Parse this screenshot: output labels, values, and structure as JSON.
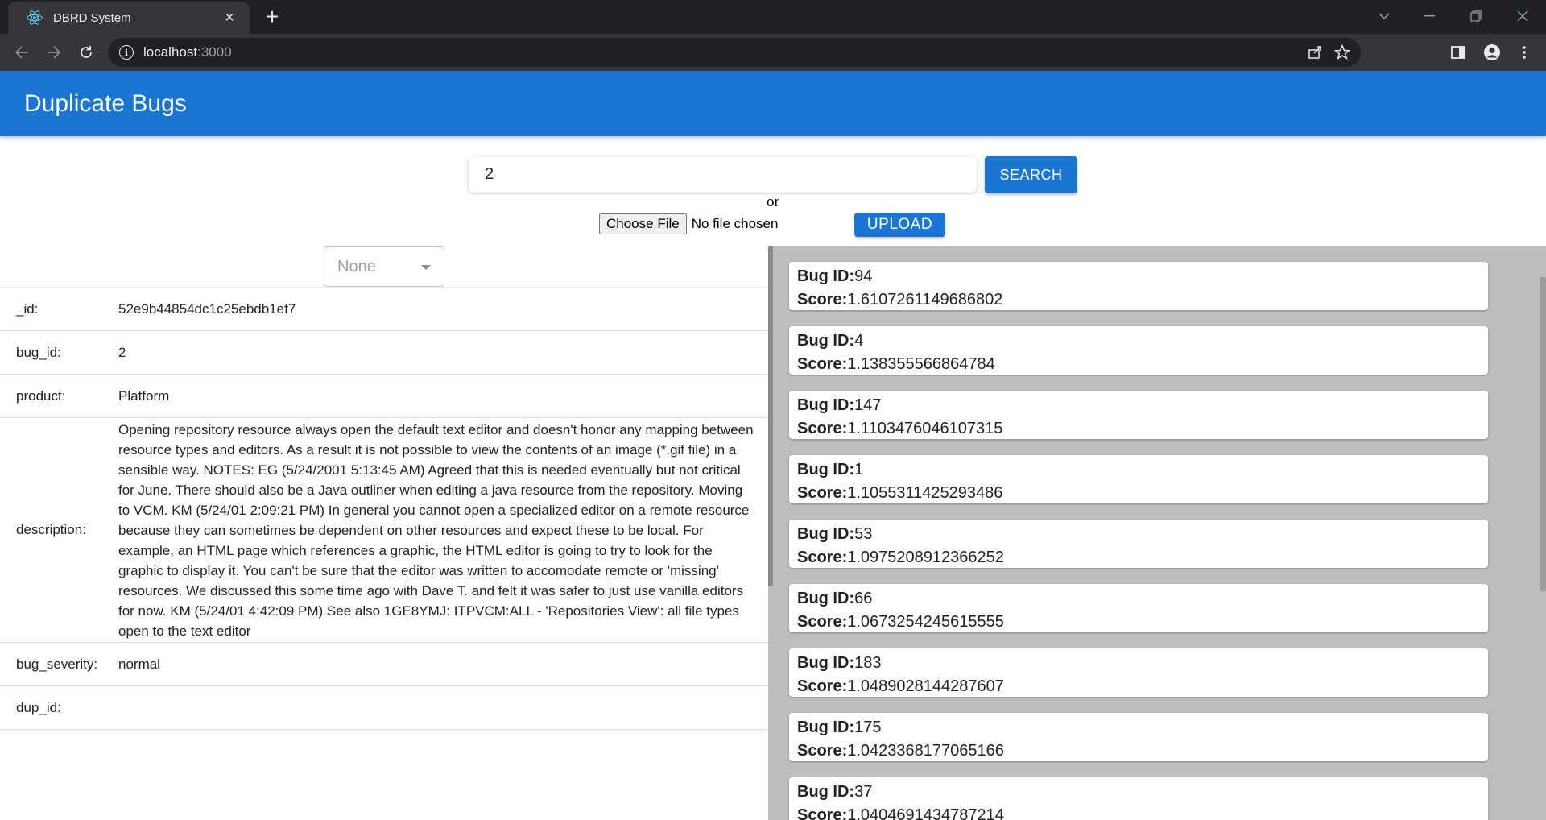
{
  "browser": {
    "tab_title": "DBRD System",
    "url_host": "localhost",
    "url_port": ":3000"
  },
  "app": {
    "title": "Duplicate Bugs"
  },
  "search": {
    "query": "2",
    "button_label": "SEARCH",
    "or_text": "or",
    "choose_file_label": "Choose File",
    "no_file_text": "No file chosen",
    "upload_label": "UPLOAD"
  },
  "selector": {
    "value": "None"
  },
  "details": [
    {
      "key": "_id:",
      "value": "52e9b44854dc1c25ebdb1ef7"
    },
    {
      "key": "bug_id:",
      "value": "2"
    },
    {
      "key": "product:",
      "value": "Platform"
    },
    {
      "key": "description:",
      "value": "Opening repository resource always open the default text editor and doesn't honor any mapping between resource types and editors. As a result it is not possible to view the contents of an image (*.gif file) in a sensible way. NOTES: EG (5/24/2001 5:13:45 AM) Agreed that this is needed eventually but not critical for June. There should also be a Java outliner when editing a java resource from the repository. Moving to VCM. KM (5/24/01 2:09:21 PM) In general you cannot open a specialized editor on a remote resource because they can sometimes be dependent on other resources and expect these to be local. For example, an HTML page which references a graphic, the HTML editor is going to try to look for the graphic to display it. You can't be sure that the editor was written to accomodate remote or 'missing' resources. We discussed this some time ago with Dave T. and felt it was safer to just use vanilla editors for now. KM (5/24/01 4:42:09 PM) See also 1GE8YMJ: ITPVCM:ALL - 'Repositories View': all file types open to the text editor"
    },
    {
      "key": "bug_severity:",
      "value": "normal"
    },
    {
      "key": "dup_id:",
      "value": ""
    }
  ],
  "results": {
    "id_label": "Bug ID:",
    "score_label": "Score:",
    "items": [
      {
        "bug_id": "94",
        "score": "1.6107261149686802"
      },
      {
        "bug_id": "4",
        "score": "1.138355566864784"
      },
      {
        "bug_id": "147",
        "score": "1.1103476046107315"
      },
      {
        "bug_id": "1",
        "score": "1.1055311425293486"
      },
      {
        "bug_id": "53",
        "score": "1.0975208912366252"
      },
      {
        "bug_id": "66",
        "score": "1.0673254245615555"
      },
      {
        "bug_id": "183",
        "score": "1.0489028144287607"
      },
      {
        "bug_id": "175",
        "score": "1.0423368177065166"
      },
      {
        "bug_id": "37",
        "score": "1.0404691434787214"
      }
    ]
  },
  "colors": {
    "primary": "#1976d2",
    "results_background": "#bdbdbd"
  }
}
